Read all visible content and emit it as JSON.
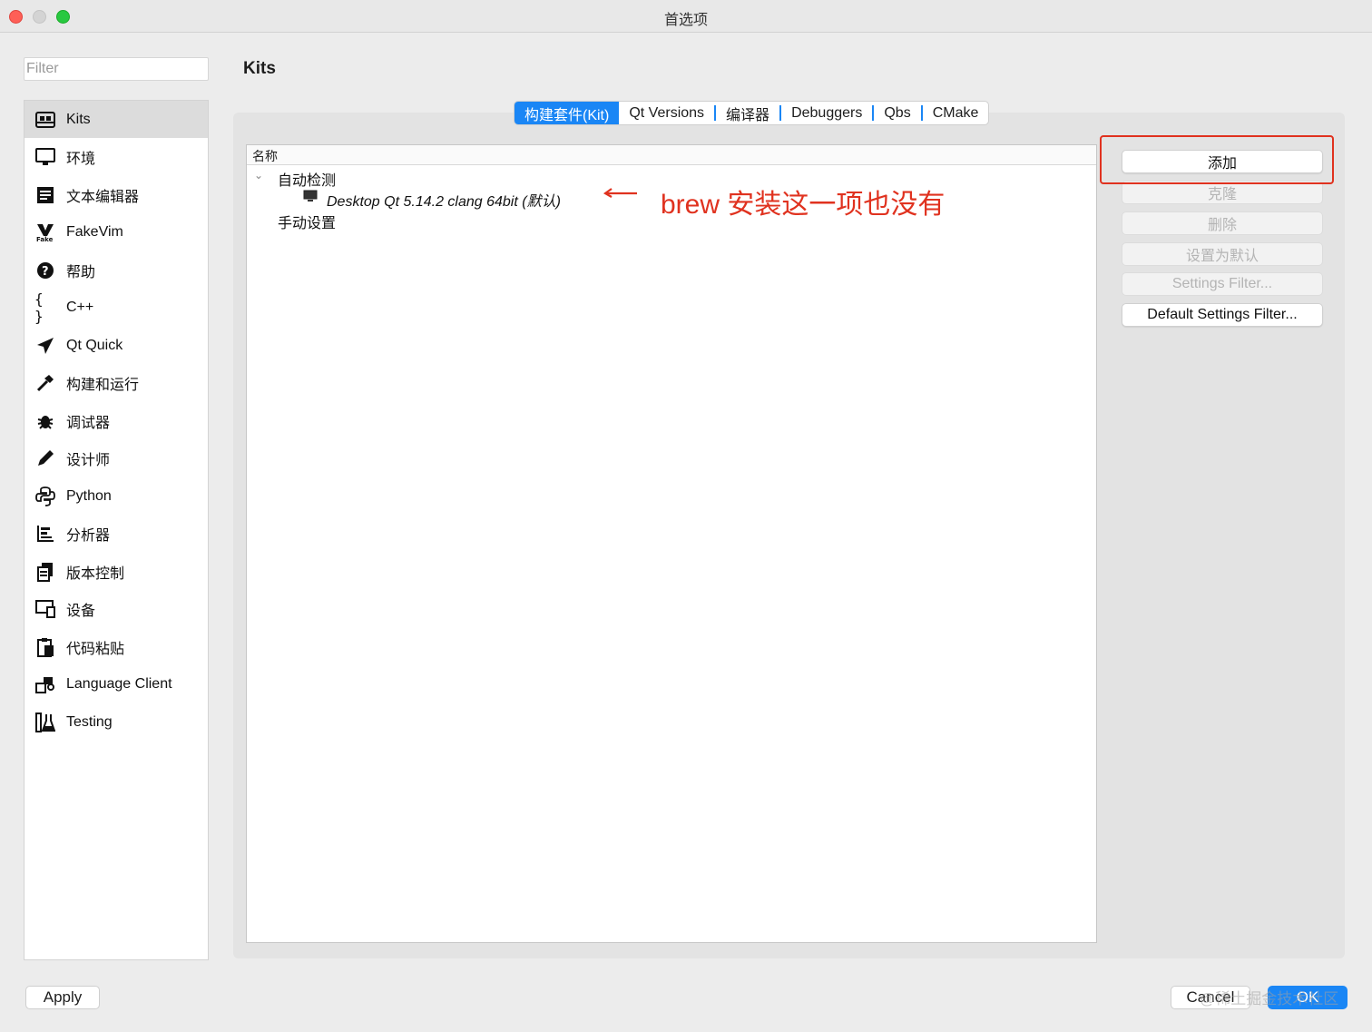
{
  "window": {
    "title": "首选项"
  },
  "filter": {
    "placeholder": "Filter"
  },
  "sidebar": {
    "items": [
      {
        "label": "Kits",
        "icon": "kits-icon"
      },
      {
        "label": "环境",
        "icon": "monitor-icon"
      },
      {
        "label": "文本编辑器",
        "icon": "text-editor-icon"
      },
      {
        "label": "FakeVim",
        "icon": "fakevim-icon"
      },
      {
        "label": "帮助",
        "icon": "help-icon"
      },
      {
        "label": "C++",
        "icon": "braces-icon"
      },
      {
        "label": "Qt Quick",
        "icon": "paper-plane-icon"
      },
      {
        "label": "构建和运行",
        "icon": "hammer-icon"
      },
      {
        "label": "调试器",
        "icon": "bug-icon"
      },
      {
        "label": "设计师",
        "icon": "pencil-icon"
      },
      {
        "label": "Python",
        "icon": "python-icon"
      },
      {
        "label": "分析器",
        "icon": "analyzer-icon"
      },
      {
        "label": "版本控制",
        "icon": "version-control-icon"
      },
      {
        "label": "设备",
        "icon": "device-icon"
      },
      {
        "label": "代码粘贴",
        "icon": "clipboard-icon"
      },
      {
        "label": "Language Client",
        "icon": "language-client-icon"
      },
      {
        "label": "Testing",
        "icon": "testing-icon"
      }
    ]
  },
  "page": {
    "title": "Kits"
  },
  "tabs": [
    {
      "label": "构建套件(Kit)"
    },
    {
      "label": "Qt Versions"
    },
    {
      "label": "编译器"
    },
    {
      "label": "Debuggers"
    },
    {
      "label": "Qbs"
    },
    {
      "label": "CMake"
    }
  ],
  "tree": {
    "header": "名称",
    "auto_group": "自动检测",
    "auto_kit": "Desktop Qt 5.14.2 clang 64bit (默认)",
    "manual_group": "手动设置"
  },
  "annotation": {
    "text": "brew 安装这一项也没有",
    "color": "#e0321f"
  },
  "buttons": {
    "add": "添加",
    "clone": "克隆",
    "remove": "删除",
    "make_default": "设置为默认",
    "settings_filter": "Settings Filter...",
    "default_settings_filter": "Default Settings Filter..."
  },
  "footer": {
    "apply": "Apply",
    "cancel": "Cancel",
    "ok": "OK",
    "watermark": "@稀土掘金技术社区"
  },
  "colors": {
    "accent": "#1a86f5",
    "annotation": "#e0321f"
  }
}
